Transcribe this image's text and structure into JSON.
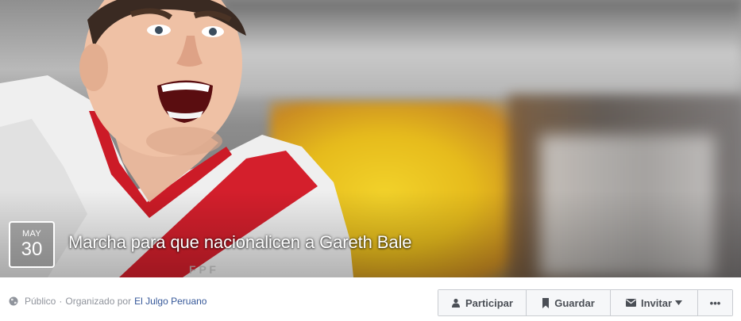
{
  "event": {
    "date": {
      "month": "MAY",
      "day": "30"
    },
    "title": "Marcha para que nacionalicen a Gareth Bale"
  },
  "meta": {
    "privacy": "Público",
    "separator": "·",
    "organized_by": "Organizado por",
    "organizer": "El Julgo Peruano"
  },
  "actions": {
    "participate_label": "Participar",
    "save_label": "Guardar",
    "invite_label": "Invitar",
    "more_label": "•••"
  },
  "icons": {
    "privacy": "globe-icon",
    "participate": "person-icon",
    "save": "bookmark-icon",
    "invite": "envelope-icon",
    "invite_caret": "caret-down-icon"
  },
  "colors": {
    "link": "#365899",
    "meta_text": "#90949c",
    "button_text": "#4b4f56",
    "button_bg": "#f6f7f9",
    "button_border": "#c9ccd1"
  }
}
